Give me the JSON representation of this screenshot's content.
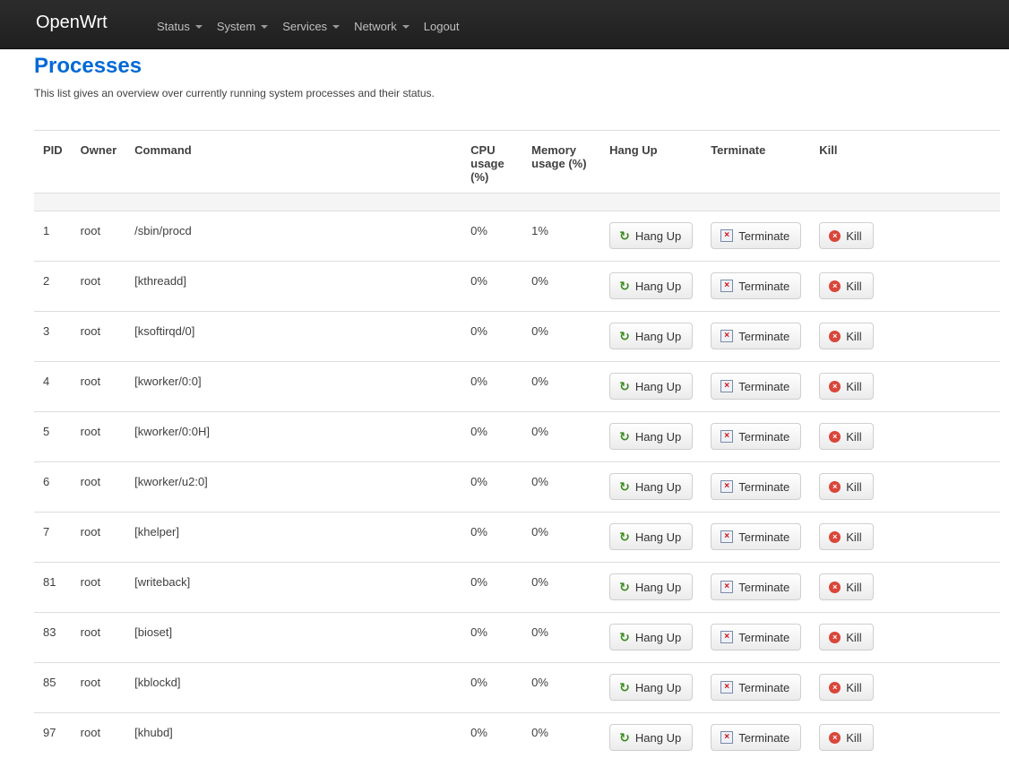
{
  "brand": "OpenWrt",
  "nav": [
    {
      "label": "Status",
      "dropdown": true
    },
    {
      "label": "System",
      "dropdown": true
    },
    {
      "label": "Services",
      "dropdown": true
    },
    {
      "label": "Network",
      "dropdown": true
    },
    {
      "label": "Logout",
      "dropdown": false
    }
  ],
  "page": {
    "title": "Processes",
    "description": "This list gives an overview over currently running system processes and their status."
  },
  "table": {
    "headers": {
      "pid": "PID",
      "owner": "Owner",
      "command": "Command",
      "cpu": "CPU usage (%)",
      "mem": "Memory usage (%)",
      "hangup": "Hang Up",
      "terminate": "Terminate",
      "kill": "Kill"
    },
    "buttons": {
      "hangup": "Hang Up",
      "terminate": "Terminate",
      "kill": "Kill"
    },
    "rows": [
      {
        "pid": "1",
        "owner": "root",
        "command": "/sbin/procd",
        "cpu": "0%",
        "mem": "1%"
      },
      {
        "pid": "2",
        "owner": "root",
        "command": "[kthreadd]",
        "cpu": "0%",
        "mem": "0%"
      },
      {
        "pid": "3",
        "owner": "root",
        "command": "[ksoftirqd/0]",
        "cpu": "0%",
        "mem": "0%"
      },
      {
        "pid": "4",
        "owner": "root",
        "command": "[kworker/0:0]",
        "cpu": "0%",
        "mem": "0%"
      },
      {
        "pid": "5",
        "owner": "root",
        "command": "[kworker/0:0H]",
        "cpu": "0%",
        "mem": "0%"
      },
      {
        "pid": "6",
        "owner": "root",
        "command": "[kworker/u2:0]",
        "cpu": "0%",
        "mem": "0%"
      },
      {
        "pid": "7",
        "owner": "root",
        "command": "[khelper]",
        "cpu": "0%",
        "mem": "0%"
      },
      {
        "pid": "81",
        "owner": "root",
        "command": "[writeback]",
        "cpu": "0%",
        "mem": "0%"
      },
      {
        "pid": "83",
        "owner": "root",
        "command": "[bioset]",
        "cpu": "0%",
        "mem": "0%"
      },
      {
        "pid": "85",
        "owner": "root",
        "command": "[kblockd]",
        "cpu": "0%",
        "mem": "0%"
      },
      {
        "pid": "97",
        "owner": "root",
        "command": "[khubd]",
        "cpu": "0%",
        "mem": "0%"
      }
    ]
  },
  "icons": {
    "hangup": "refresh-icon",
    "terminate": "terminate-icon",
    "kill": "kill-icon"
  },
  "colors": {
    "title": "#0069d6",
    "topbar": "#222222"
  }
}
